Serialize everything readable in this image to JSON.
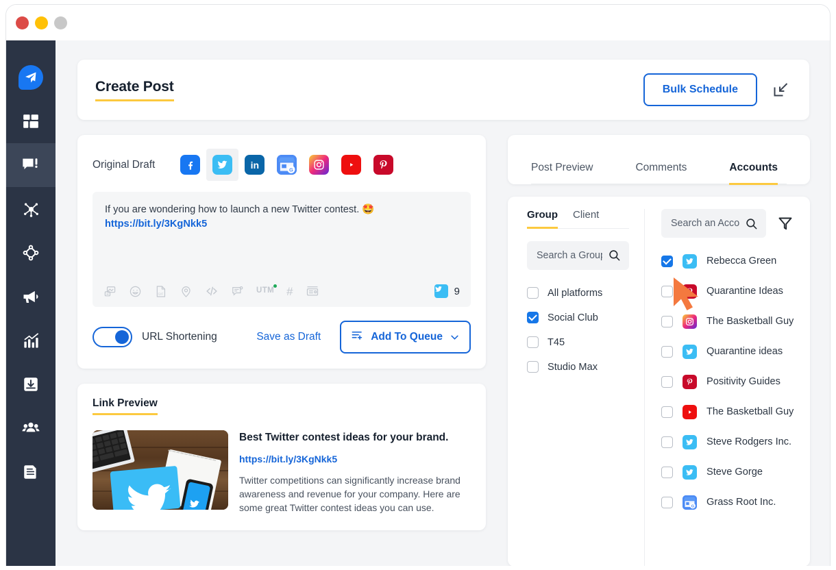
{
  "window": {
    "controls": [
      "close",
      "minimize",
      "maximize"
    ]
  },
  "sidebar": {
    "items": [
      {
        "name": "logo",
        "icon": "paper-plane-icon",
        "active": false
      },
      {
        "name": "dashboard",
        "icon": "grid-dashboard-icon",
        "active": false
      },
      {
        "name": "compose",
        "icon": "compose-message-icon",
        "active": true
      },
      {
        "name": "network",
        "icon": "network-share-icon",
        "active": false
      },
      {
        "name": "discovery",
        "icon": "diamond-nodes-icon",
        "active": false
      },
      {
        "name": "campaigns",
        "icon": "megaphone-icon",
        "active": false
      },
      {
        "name": "analytics",
        "icon": "bar-chart-icon",
        "active": false
      },
      {
        "name": "inbox",
        "icon": "download-inbox-icon",
        "active": false
      },
      {
        "name": "team",
        "icon": "team-users-icon",
        "active": false
      },
      {
        "name": "reports",
        "icon": "report-document-icon",
        "active": false
      }
    ]
  },
  "header": {
    "title": "Create Post",
    "bulk_schedule_label": "Bulk Schedule",
    "collapse_icon": "collapse-arrow-icon",
    "accent_color": "#fcc93f",
    "primary_color": "#1565d8"
  },
  "compose": {
    "draft_label": "Original Draft",
    "platforms": [
      {
        "id": "facebook",
        "label": "Facebook",
        "selected": false
      },
      {
        "id": "twitter",
        "label": "Twitter",
        "selected": true
      },
      {
        "id": "linkedin",
        "label": "LinkedIn",
        "selected": false
      },
      {
        "id": "google-business",
        "label": "Google Business",
        "selected": false
      },
      {
        "id": "instagram",
        "label": "Instagram",
        "selected": false
      },
      {
        "id": "youtube",
        "label": "YouTube",
        "selected": false
      },
      {
        "id": "pinterest",
        "label": "Pinterest",
        "selected": false
      }
    ],
    "editor": {
      "text": "If you are wondering how to launch a new Twitter contest. 🤩",
      "link": "https://bit.ly/3KgNkk5"
    },
    "toolbar": [
      {
        "icon": "media-image-icon",
        "label": "Media"
      },
      {
        "icon": "emoji-smiley-icon",
        "label": "Emoji"
      },
      {
        "icon": "gif-file-icon",
        "label": "GIF"
      },
      {
        "icon": "location-pin-icon",
        "label": "Location"
      },
      {
        "icon": "code-brackets-icon",
        "label": "Code"
      },
      {
        "icon": "comment-note-icon",
        "label": "Note"
      },
      {
        "icon": "utm-tag-icon",
        "label": "UTM"
      },
      {
        "icon": "hashtag-icon",
        "label": "Hashtag"
      },
      {
        "icon": "card-preview-icon",
        "label": "Card"
      }
    ],
    "counter": {
      "platform": "twitter",
      "value": "9"
    },
    "url_shortening_label": "URL Shortening",
    "url_shortening_on": true,
    "save_draft_label": "Save as Draft",
    "queue_label": "Add To Queue",
    "queue_icon": "queue-list-icon",
    "queue_caret": "chevron-down-icon"
  },
  "link_preview": {
    "section_title": "Link Preview",
    "title": "Best Twitter contest ideas for your brand.",
    "url": "https://bit.ly/3KgNkk5",
    "description": "Twitter competitions can significantly increase brand awareness and revenue for your company. Here are some great Twitter contest ideas you can use.",
    "thumbnail_alt": "laptop, wooden desk, notebook and phone with Twitter bird logo"
  },
  "right_panel": {
    "tabs": [
      {
        "label": "Post Preview",
        "active": false
      },
      {
        "label": "Comments",
        "active": false
      },
      {
        "label": "Accounts",
        "active": true
      }
    ],
    "group_section": {
      "subtabs": [
        {
          "label": "Group",
          "active": true
        },
        {
          "label": "Client",
          "active": false
        }
      ],
      "search_placeholder": "Search a Group",
      "search_value": "",
      "search_icon": "search-icon",
      "groups": [
        {
          "label": "All platforms",
          "checked": false
        },
        {
          "label": "Social Club",
          "checked": true
        },
        {
          "label": "T45",
          "checked": false
        },
        {
          "label": "Studio Max",
          "checked": false
        }
      ]
    },
    "accounts_section": {
      "search_placeholder": "Search an Account",
      "search_value": "",
      "search_icon": "search-icon",
      "filter_icon": "filter-funnel-icon",
      "accounts": [
        {
          "name": "Rebecca Green",
          "platform": "twitter",
          "checked": true
        },
        {
          "name": "Quarantine Ideas",
          "platform": "pinterest",
          "checked": false
        },
        {
          "name": "The Basketball Guy",
          "platform": "instagram",
          "checked": false
        },
        {
          "name": "Quarantine ideas",
          "platform": "twitter",
          "checked": false
        },
        {
          "name": "Positivity Guides",
          "platform": "pinterest",
          "checked": false
        },
        {
          "name": "The Basketball Guy",
          "platform": "youtube",
          "checked": false
        },
        {
          "name": "Steve Rodgers Inc.",
          "platform": "twitter",
          "checked": false
        },
        {
          "name": "Steve Gorge",
          "platform": "twitter",
          "checked": false
        },
        {
          "name": "Grass Root Inc.",
          "platform": "google-business",
          "checked": false
        }
      ]
    }
  },
  "cursor": {
    "icon": "mouse-pointer-icon",
    "color": "#f4793f"
  }
}
